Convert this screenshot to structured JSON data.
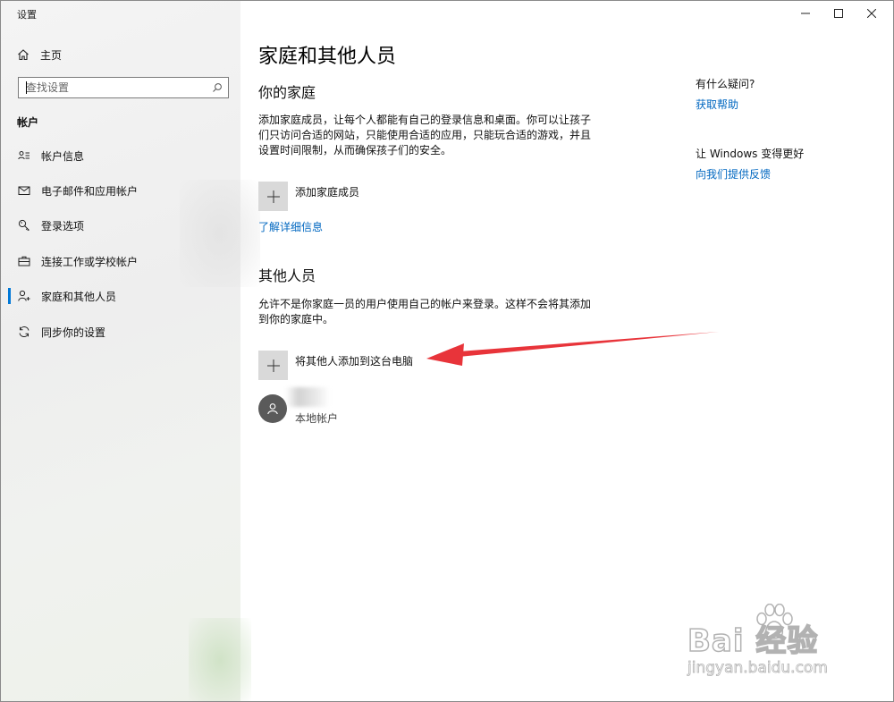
{
  "window": {
    "title": "设置"
  },
  "sidebar": {
    "home_label": "主页",
    "search_placeholder": "查找设置",
    "section_label": "帐户",
    "items": [
      {
        "label": "帐户信息",
        "icon": "account-info-icon"
      },
      {
        "label": "电子邮件和应用帐户",
        "icon": "mail-icon"
      },
      {
        "label": "登录选项",
        "icon": "key-icon"
      },
      {
        "label": "连接工作或学校帐户",
        "icon": "briefcase-icon"
      },
      {
        "label": "家庭和其他人员",
        "icon": "person-add-icon",
        "active": true
      },
      {
        "label": "同步你的设置",
        "icon": "sync-icon"
      }
    ]
  },
  "main": {
    "title": "家庭和其他人员",
    "family": {
      "heading": "你的家庭",
      "description": "添加家庭成员，让每个人都能有自己的登录信息和桌面。你可以让孩子们只访问合适的网站，只能使用合适的应用，只能玩合适的游戏，并且设置时间限制，从而确保孩子们的安全。",
      "add_label": "添加家庭成员",
      "learn_more": "了解详细信息"
    },
    "others": {
      "heading": "其他人员",
      "description": "允许不是你家庭一员的用户使用自己的帐户来登录。这样不会将其添加到你的家庭中。",
      "add_label": "将其他人添加到这台电脑",
      "user_type": "本地帐户"
    }
  },
  "aside": {
    "question": "有什么疑问?",
    "help_link": "获取帮助",
    "improve": "让 Windows 变得更好",
    "feedback_link": "向我们提供反馈"
  },
  "watermark": {
    "main": "Bai  经验",
    "sub": "jingyan.baidu.com"
  },
  "colors": {
    "accent": "#0078d7",
    "link": "#0067c0",
    "arrow": "#e8343a"
  }
}
